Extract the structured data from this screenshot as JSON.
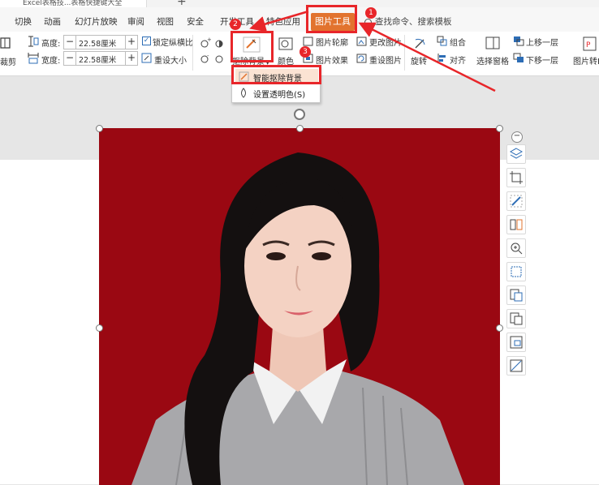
{
  "titlebar": {
    "doc_title": "Excel表格技...表格快捷键大全",
    "new_tab": "+"
  },
  "menu": {
    "items": [
      "切换",
      "动画",
      "幻灯片放映",
      "审阅",
      "视图",
      "安全",
      "开发工具",
      "特色应用"
    ],
    "active_tab": "图片工具",
    "search_placeholder": "查找命令、搜索模板"
  },
  "ribbon": {
    "crop_label": "裁剪",
    "height_label": "高度:",
    "width_label": "宽度:",
    "height_value": "22.58厘米",
    "width_value": "22.58厘米",
    "lock_ratio_label": "锁定纵横比",
    "reset_size_label": "重设大小",
    "remove_bg_label": "抠除背景",
    "color_label": "颜色",
    "outline_label": "图片轮廓",
    "effect_label": "图片效果",
    "change_picture_label": "更改图片",
    "reset_picture_label": "重设图片",
    "rotate_label": "旋转",
    "group_label": "组合",
    "align_label": "对齐",
    "selection_pane_label": "选择窗格",
    "bring_forward_label": "上移一层",
    "send_backward_label": "下移一层",
    "pic_to_pdf_label": "图片转P"
  },
  "dropdown": {
    "items": [
      "智能抠除背景",
      "设置透明色(S)"
    ]
  },
  "annotations": {
    "step1": "1",
    "step2": "2",
    "step3": "3"
  },
  "colors": {
    "accent": "#e2732e",
    "annotation_red": "#e8262a",
    "photo_background": "#9a0812"
  }
}
